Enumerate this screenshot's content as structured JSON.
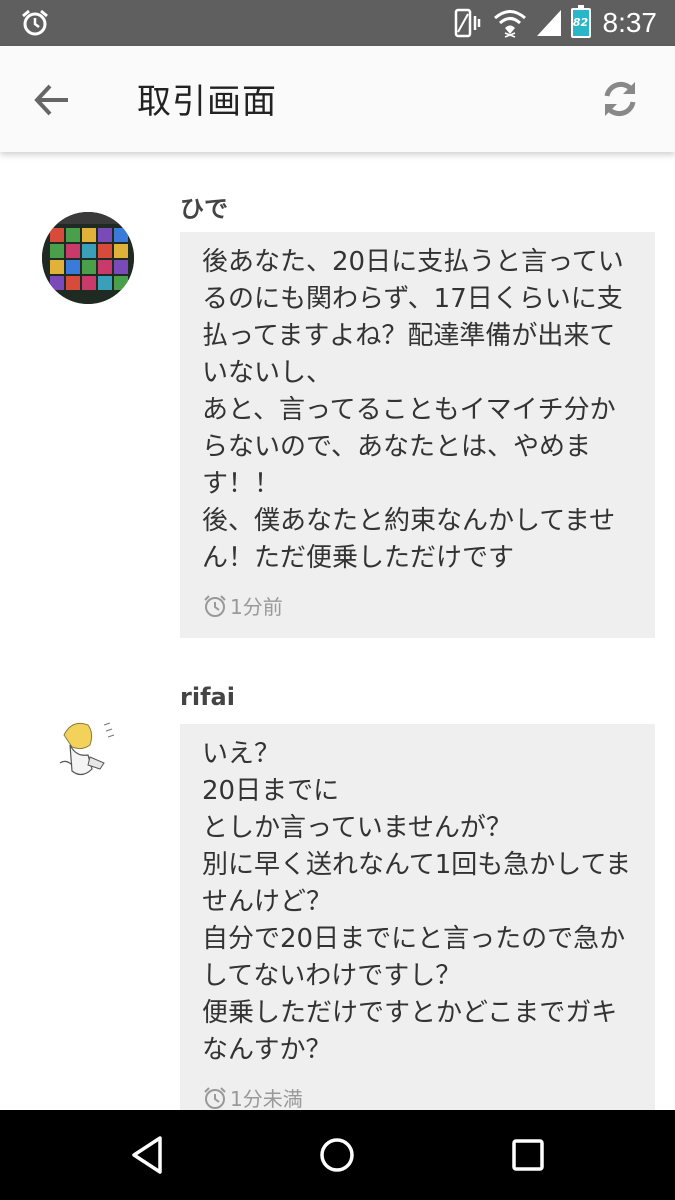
{
  "status_bar": {
    "time": "8:37",
    "battery_level": "82",
    "icons": [
      "alarm-icon",
      "vibrate-icon",
      "wifi-icon",
      "cell-signal-icon",
      "battery-icon"
    ]
  },
  "app_bar": {
    "title": "取引画面",
    "back_icon": "arrow-left-icon",
    "refresh_icon": "refresh-icon"
  },
  "messages": [
    {
      "sender": "ひで",
      "avatar": "avatar-game-screenshot",
      "text": "後あなた、20日に支払うと言っているのにも関わらず、17日くらいに支払ってますよね？配達準備が出来ていないし、\nあと、言ってることもイマイチ分からないので、あなたとは、やめます！！\n後、僕あなたと約束なんかしてません！ただ便乗しただけです",
      "time": "1分前"
    },
    {
      "sender": "rifai",
      "avatar": "avatar-character-sketch",
      "text": "いえ？\n20日までに\nとしか言っていませんが？\n別に早く送れなんて1回も急かしてませんけど？\n自分で20日までにと言ったので急かしてないわけですし？\n便乗しただけですとかどこまでガキなんすか？",
      "time": "1分未満"
    }
  ],
  "colors": {
    "status_bar": "#5f5f5f",
    "app_bar": "#fafafa",
    "bubble": "#efefef",
    "nav_bar": "#000000",
    "battery": "#29b6c8"
  }
}
